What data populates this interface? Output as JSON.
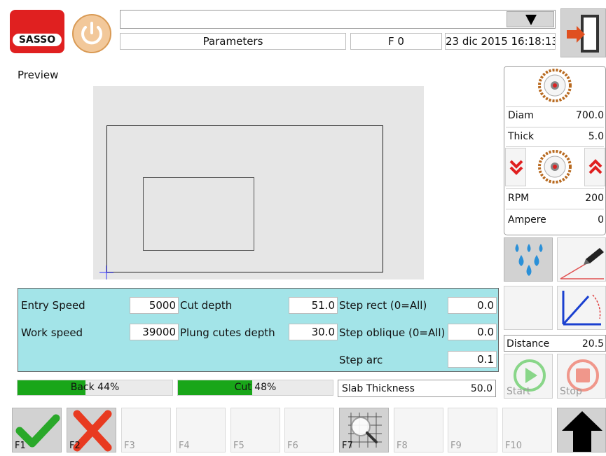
{
  "header": {
    "logo_text": "SASSO",
    "status_bar_text": "",
    "title": "Parameters",
    "function_indicator": "F 0",
    "datetime": "23 dic 2015 16:18:13"
  },
  "preview": {
    "label": "Preview"
  },
  "blade": {
    "diam_label": "Diam",
    "diam_value": "700.0",
    "thick_label": "Thick",
    "thick_value": "5.0",
    "rpm_label": "RPM",
    "rpm_value": "200",
    "ampere_label": "Ampere",
    "ampere_value": "0"
  },
  "params": {
    "entry_speed_label": "Entry Speed",
    "entry_speed_value": "5000",
    "work_speed_label": "Work speed",
    "work_speed_value": "39000",
    "cut_depth_label": "Cut depth",
    "cut_depth_value": "51.0",
    "plung_label": "Plung cutes depth",
    "plung_value": "30.0",
    "step_rect_label": "Step rect (0=All)",
    "step_rect_value": "0.0",
    "step_oblique_label": "Step oblique (0=All)",
    "step_oblique_value": "0.0",
    "step_arc_label": "Step arc",
    "step_arc_value": "0.1"
  },
  "progress": {
    "back_label": "Back 44%",
    "back_fraction": 0.44,
    "cut_label": "Cut 48%",
    "cut_fraction": 0.48
  },
  "slab": {
    "label": "Slab Thickness",
    "value": "50.0"
  },
  "distance": {
    "label": "Distance",
    "value": "20.5"
  },
  "controls": {
    "start_label": "Start",
    "stop_label": "Stop"
  },
  "fkeys": [
    "F1",
    "F2",
    "F3",
    "F4",
    "F5",
    "F6",
    "F7",
    "F8",
    "F9",
    "F10"
  ],
  "colors": {
    "accent_cyan": "#a3e4e8",
    "progress_green": "#19a619",
    "logo_red": "#e02020",
    "alert_red": "#e02020"
  }
}
